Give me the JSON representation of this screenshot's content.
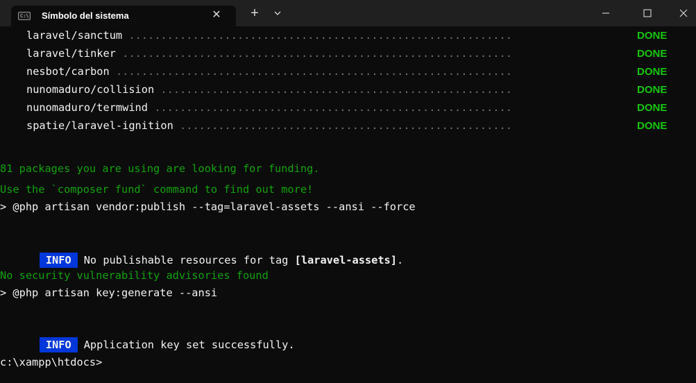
{
  "window": {
    "tab_title": "Símbolo del sistema",
    "tab_icon_text": "C:\\",
    "icons": {
      "tab_icon": "command-prompt-icon",
      "close_tab": "close-icon",
      "new_tab": "plus-icon",
      "dropdown": "chevron-down-icon",
      "minimize": "minimize-icon",
      "maximize": "maximize-icon",
      "close_window": "close-icon"
    },
    "glyphs": {
      "close_tab": "✕",
      "new_tab": "+"
    }
  },
  "colors": {
    "background": "#0c0c0c",
    "titlebar": "#202020",
    "green_text": "#13a10e",
    "done_text": "#16c60c",
    "info_badge": "#0037da",
    "normal_text": "#cccccc"
  },
  "terminal": {
    "packages": [
      {
        "name": "laravel/sanctum",
        "dots": " ............................................................",
        "status": "DONE"
      },
      {
        "name": "laravel/tinker",
        "dots": " .............................................................",
        "status": "DONE"
      },
      {
        "name": "nesbot/carbon",
        "dots": " ..............................................................",
        "status": "DONE"
      },
      {
        "name": "nunomaduro/collision",
        "dots": " .......................................................",
        "status": "DONE"
      },
      {
        "name": "nunomaduro/termwind",
        "dots": " ........................................................",
        "status": "DONE"
      },
      {
        "name": "spatie/laravel-ignition",
        "dots": " ....................................................",
        "status": "DONE"
      }
    ],
    "funding_line_1": "81 packages you are using are looking for funding.",
    "funding_line_2": "Use the `composer fund` command to find out more!",
    "command_1": "> @php artisan vendor:publish --tag=laravel-assets --ansi --force",
    "info_label": "INFO",
    "info_1_text": "No publishable resources for tag ",
    "info_1_tag": "[laravel-assets]",
    "info_1_end": ".",
    "security_line": "No security vulnerability advisories found",
    "command_2": "> @php artisan key:generate --ansi",
    "info_2_text": "Application key set successfully.",
    "prompt": "c:\\xampp\\htdocs>"
  }
}
